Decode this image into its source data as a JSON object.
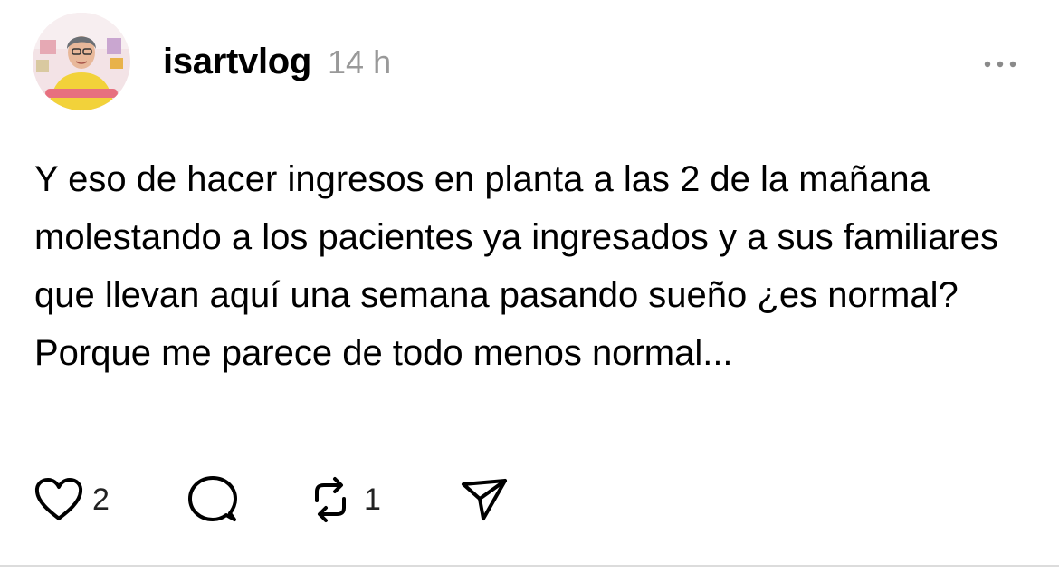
{
  "post": {
    "avatar_icon": "profile-photo",
    "username": "isartvlog",
    "timestamp": "14 h",
    "more_icon": "ellipsis-icon",
    "text": "Y eso de hacer ingresos en planta a las 2 de la mañana molestando a los pacientes ya ingresados y a sus familiares que llevan aquí una semana pasando sueño ¿es normal? Porque me parece de todo menos normal..."
  },
  "actions": {
    "like": {
      "icon": "heart-icon",
      "count": "2"
    },
    "reply": {
      "icon": "comment-icon"
    },
    "repost": {
      "icon": "repost-icon",
      "count": "1"
    },
    "share": {
      "icon": "send-icon"
    }
  },
  "colors": {
    "text": "#000000",
    "timestamp": "#999999",
    "icon": "#000000",
    "divider": "#dcdcdc"
  }
}
